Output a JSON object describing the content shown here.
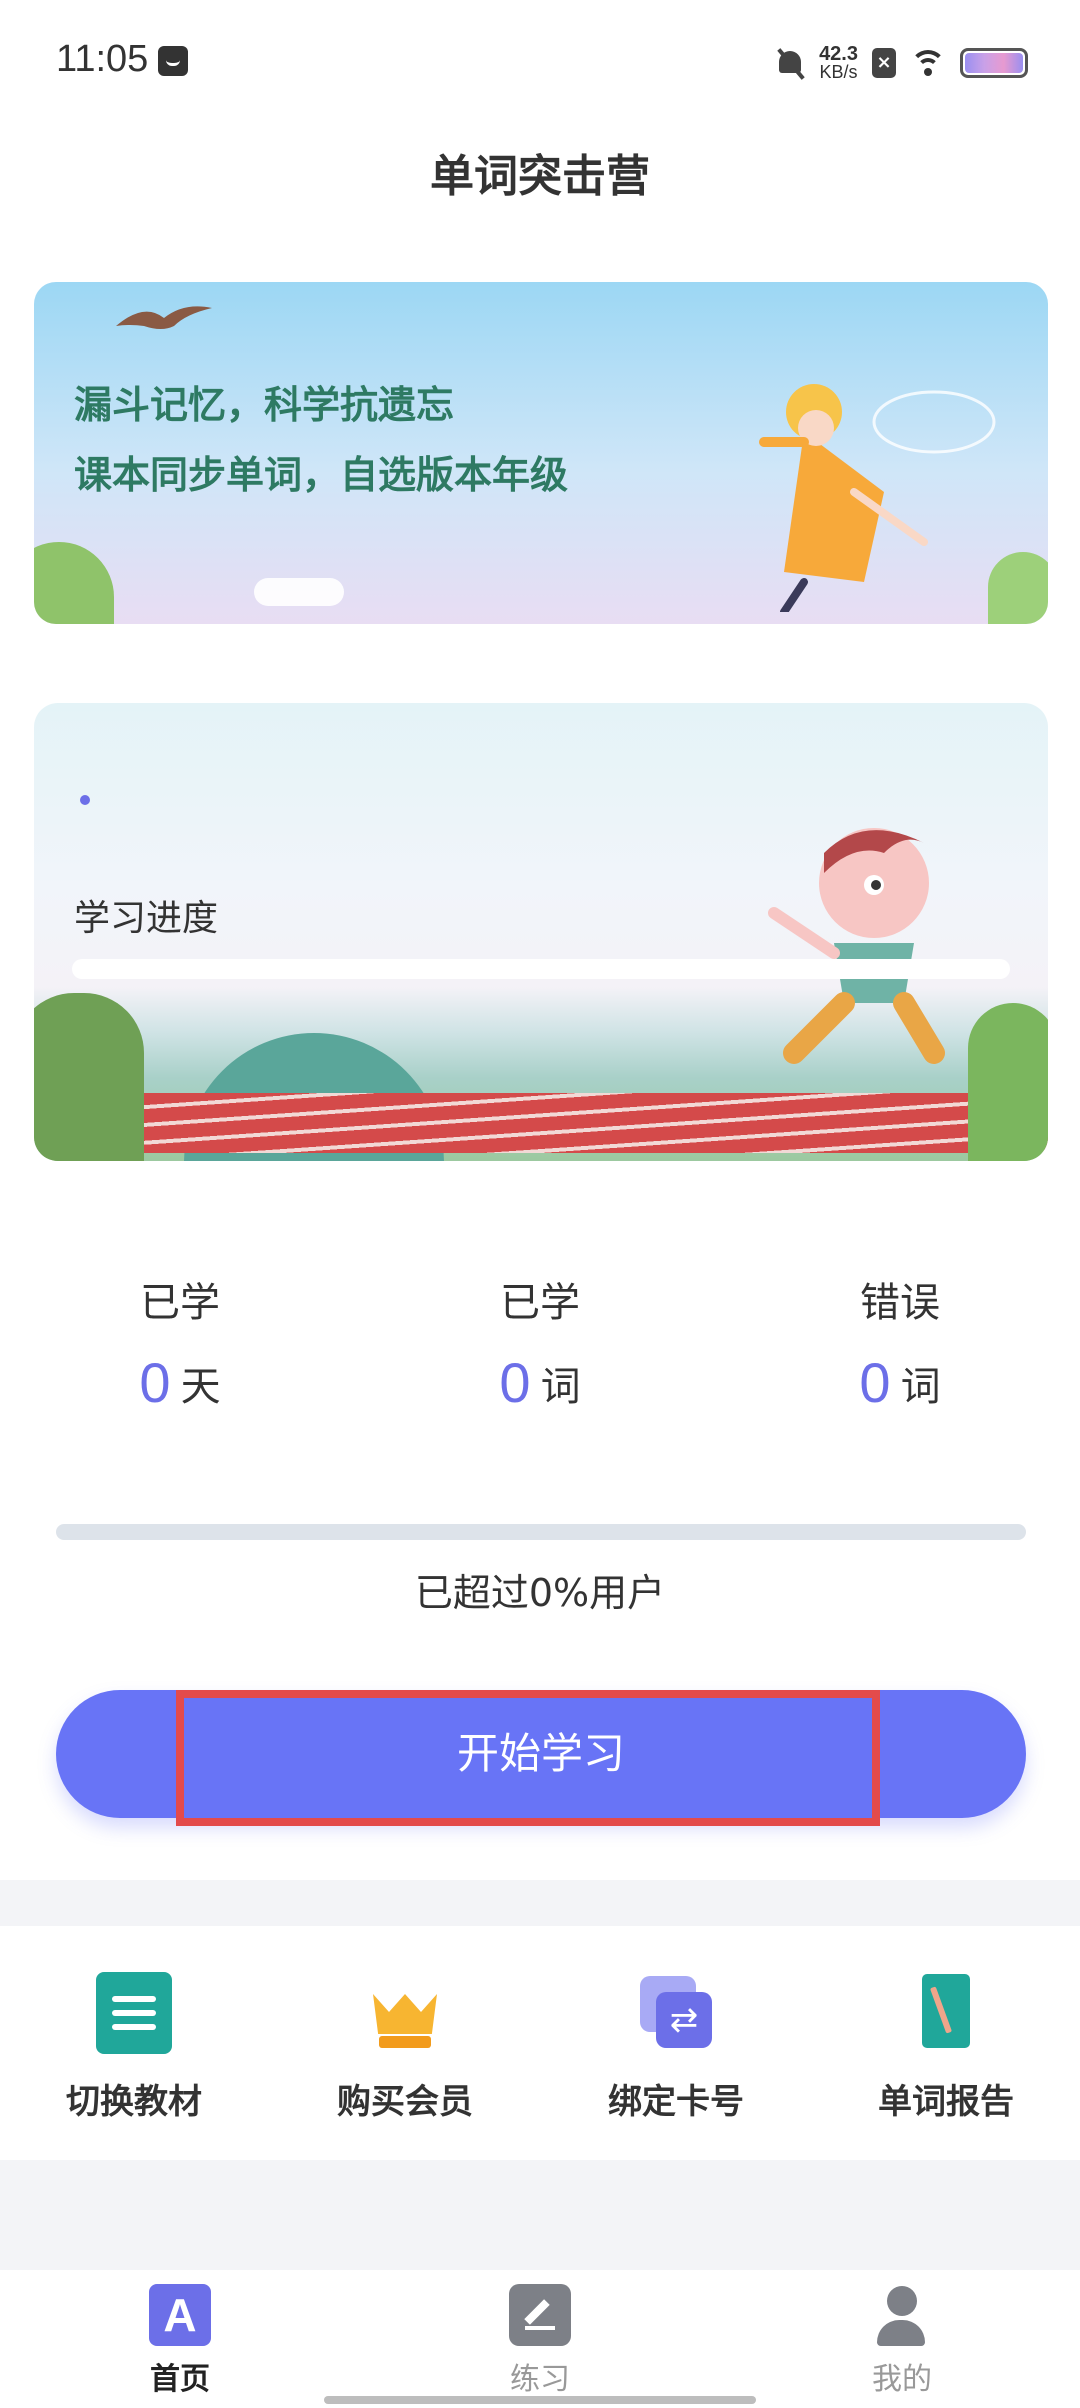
{
  "status_bar": {
    "time": "11:05",
    "net_speed_value": "42.3",
    "net_speed_unit": "KB/s",
    "icons": [
      "message-icon",
      "bell-off-icon",
      "sim-x-icon",
      "wifi-icon",
      "battery-icon"
    ]
  },
  "header": {
    "title": "单词突击营"
  },
  "banner": {
    "line1": "漏斗记忆，科学抗遗忘",
    "line2": "课本同步单词，自选版本年级"
  },
  "progress_card": {
    "label": "学习进度",
    "progress_fraction": 0
  },
  "stats": [
    {
      "title": "已学",
      "value": "0",
      "unit": "天"
    },
    {
      "title": "已学",
      "value": "0",
      "unit": "词"
    },
    {
      "title": "错误",
      "value": "0",
      "unit": "词"
    }
  ],
  "overall": {
    "fraction": 0,
    "text": "已超过0%用户"
  },
  "start_button": {
    "label": "开始学习"
  },
  "quick_menu": [
    {
      "label": "切换教材",
      "icon": "book-icon"
    },
    {
      "label": "购买会员",
      "icon": "crown-icon"
    },
    {
      "label": "绑定卡号",
      "icon": "card-swap-icon"
    },
    {
      "label": "单词报告",
      "icon": "report-icon"
    }
  ],
  "bottom_nav": [
    {
      "label": "首页",
      "icon": "home-a-icon",
      "active": true
    },
    {
      "label": "练习",
      "icon": "practice-edit-icon",
      "active": false
    },
    {
      "label": "我的",
      "icon": "user-settings-icon",
      "active": false
    }
  ],
  "colors": {
    "accent": "#6c6fe8",
    "button": "#6874f6",
    "highlight": "#e34b4b",
    "teal": "#20a79a"
  }
}
